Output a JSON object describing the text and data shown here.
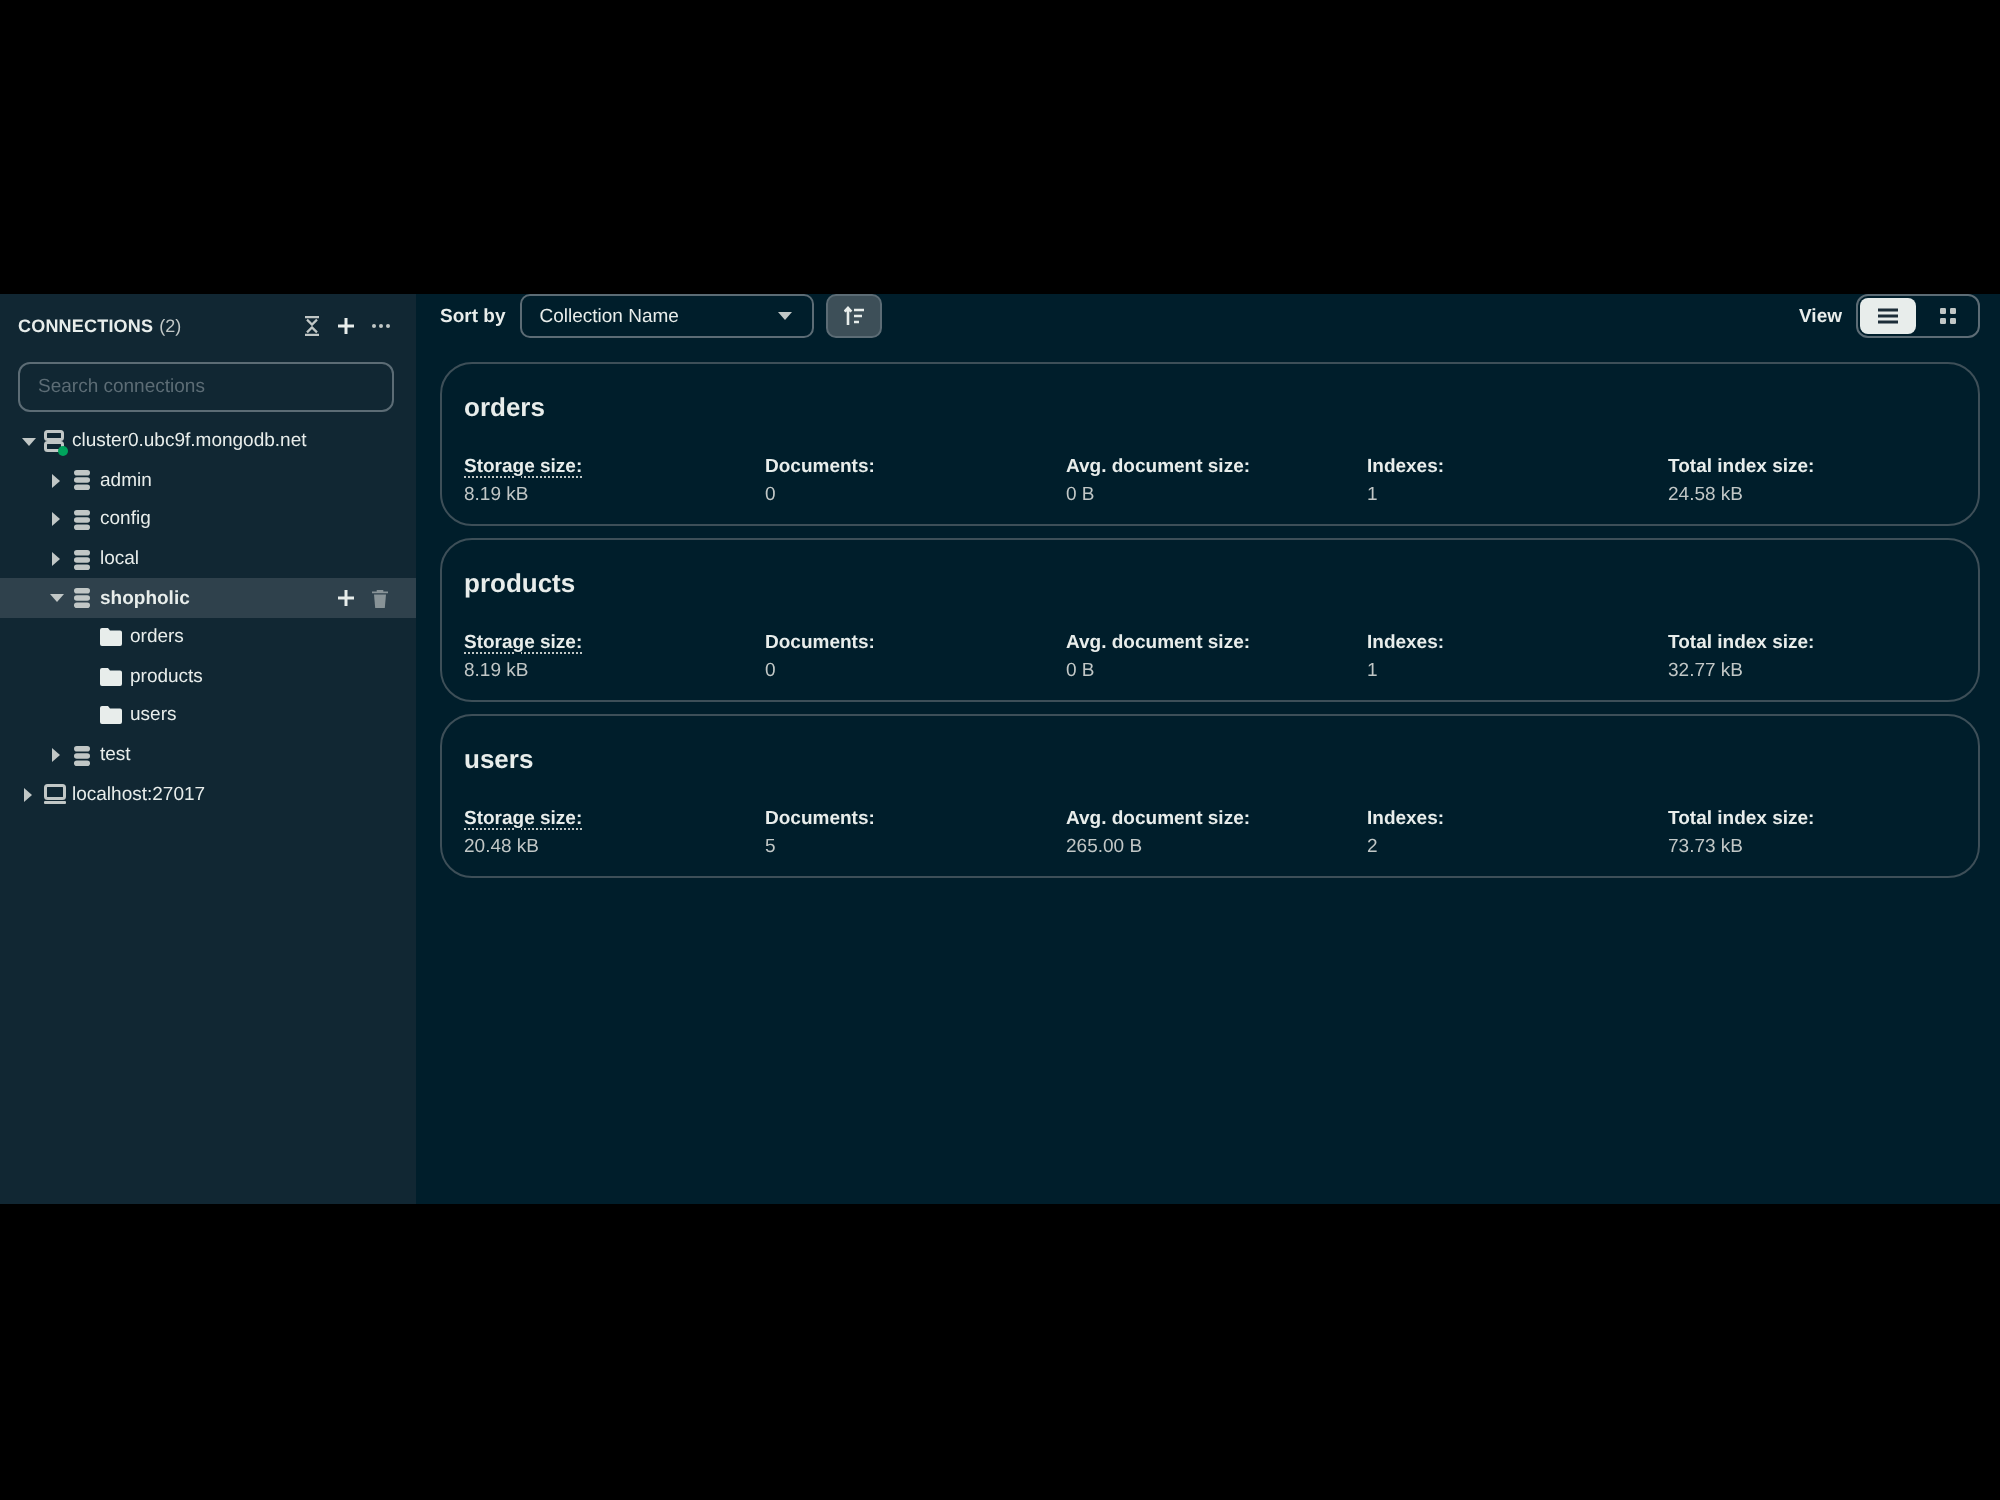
{
  "sidebar": {
    "title": "CONNECTIONS",
    "count": "(2)",
    "search": {
      "placeholder": "Search connections"
    },
    "connections": [
      {
        "name": "cluster0.ubc9f.mongodb.net",
        "kind": "cluster",
        "connected": true,
        "expanded": true,
        "selected": false,
        "children": [
          {
            "name": "admin",
            "kind": "database",
            "expanded": false,
            "selected": false
          },
          {
            "name": "config",
            "kind": "database",
            "expanded": false,
            "selected": false
          },
          {
            "name": "local",
            "kind": "database",
            "expanded": false,
            "selected": false
          },
          {
            "name": "shopholic",
            "kind": "database",
            "expanded": true,
            "selected": true,
            "children": [
              {
                "name": "orders",
                "kind": "collection",
                "selected": false
              },
              {
                "name": "products",
                "kind": "collection",
                "selected": false
              },
              {
                "name": "users",
                "kind": "collection",
                "selected": false
              }
            ]
          },
          {
            "name": "test",
            "kind": "database",
            "expanded": false,
            "selected": false
          }
        ]
      },
      {
        "name": "localhost:27017",
        "kind": "local",
        "connected": false,
        "expanded": false,
        "selected": false
      }
    ]
  },
  "toolbar": {
    "sort_label": "Sort by",
    "sort_select": {
      "value": "Collection Name"
    },
    "view_label": "View",
    "views": [
      {
        "kind": "list",
        "selected": true
      },
      {
        "kind": "grid",
        "selected": false
      }
    ]
  },
  "collections": [
    {
      "name": "orders",
      "stats": [
        {
          "label": "Storage size:",
          "value": "8.19 kB",
          "underlined": true
        },
        {
          "label": "Documents:",
          "value": "0",
          "underlined": false
        },
        {
          "label": "Avg. document size:",
          "value": "0 B",
          "underlined": false
        },
        {
          "label": "Indexes:",
          "value": "1",
          "underlined": false
        },
        {
          "label": "Total index size:",
          "value": "24.58 kB",
          "underlined": false
        }
      ]
    },
    {
      "name": "products",
      "stats": [
        {
          "label": "Storage size:",
          "value": "8.19 kB",
          "underlined": true
        },
        {
          "label": "Documents:",
          "value": "0",
          "underlined": false
        },
        {
          "label": "Avg. document size:",
          "value": "0 B",
          "underlined": false
        },
        {
          "label": "Indexes:",
          "value": "1",
          "underlined": false
        },
        {
          "label": "Total index size:",
          "value": "32.77 kB",
          "underlined": false
        }
      ]
    },
    {
      "name": "users",
      "stats": [
        {
          "label": "Storage size:",
          "value": "20.48 kB",
          "underlined": true
        },
        {
          "label": "Documents:",
          "value": "5",
          "underlined": false
        },
        {
          "label": "Avg. document size:",
          "value": "265.00 B",
          "underlined": false
        },
        {
          "label": "Indexes:",
          "value": "2",
          "underlined": false
        },
        {
          "label": "Total index size:",
          "value": "73.73 kB",
          "underlined": false
        }
      ]
    }
  ]
}
